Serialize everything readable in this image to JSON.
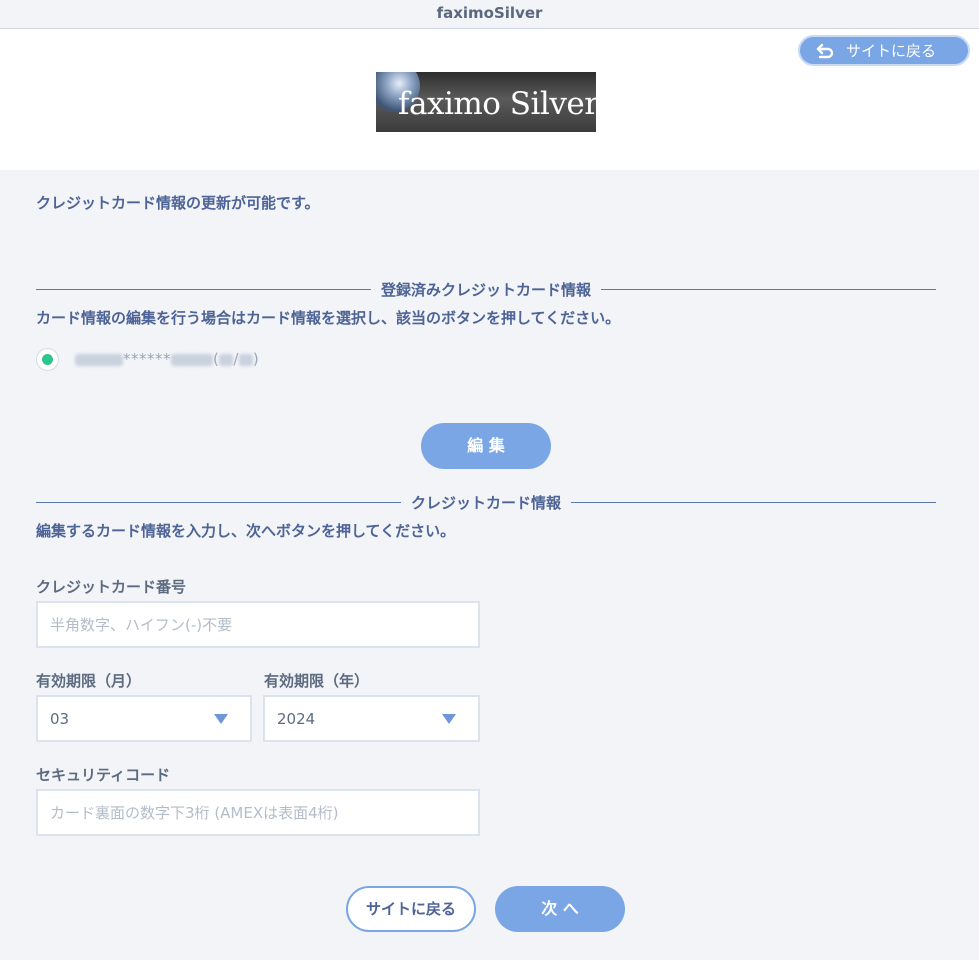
{
  "window": {
    "title": "faximoSilver"
  },
  "header": {
    "back_button_label": "サイトに戻る",
    "logo_text": "faximo Silver"
  },
  "intro_text": "クレジットカード情報の更新が可能です。",
  "registered": {
    "heading": "登録済みクレジットカード情報",
    "description": "カード情報の編集を行う場合はカード情報を選択し、該当のボタンを押してください。",
    "card_masked": "******",
    "card_paren_open": "(",
    "card_slash": "/",
    "card_paren_close": ")",
    "radio_selected": true,
    "edit_button_label": "編 集"
  },
  "card_form": {
    "heading": "クレジットカード情報",
    "description": "編集するカード情報を入力し、次へボタンを押してください。",
    "card_number_label": "クレジットカード番号",
    "card_number_placeholder": "半角数字、ハイフン(-)不要",
    "expiry_month_label": "有効期限（月）",
    "expiry_month_value": "03",
    "expiry_year_label": "有効期限（年）",
    "expiry_year_value": "2024",
    "security_code_label": "セキュリティコード",
    "security_code_placeholder": "カード裏面の数字下3桁 (AMEXは表面4桁)"
  },
  "footer": {
    "back_button_label": "サイトに戻る",
    "next_button_label": "次 へ"
  },
  "colors": {
    "accent": "#7aa6e6",
    "text_primary": "#4e6496",
    "radio_selected": "#2ec48e",
    "background": "#f2f4f8"
  },
  "icons": {
    "back": "return-arrow-icon",
    "select_caret": "chevron-down-icon"
  }
}
